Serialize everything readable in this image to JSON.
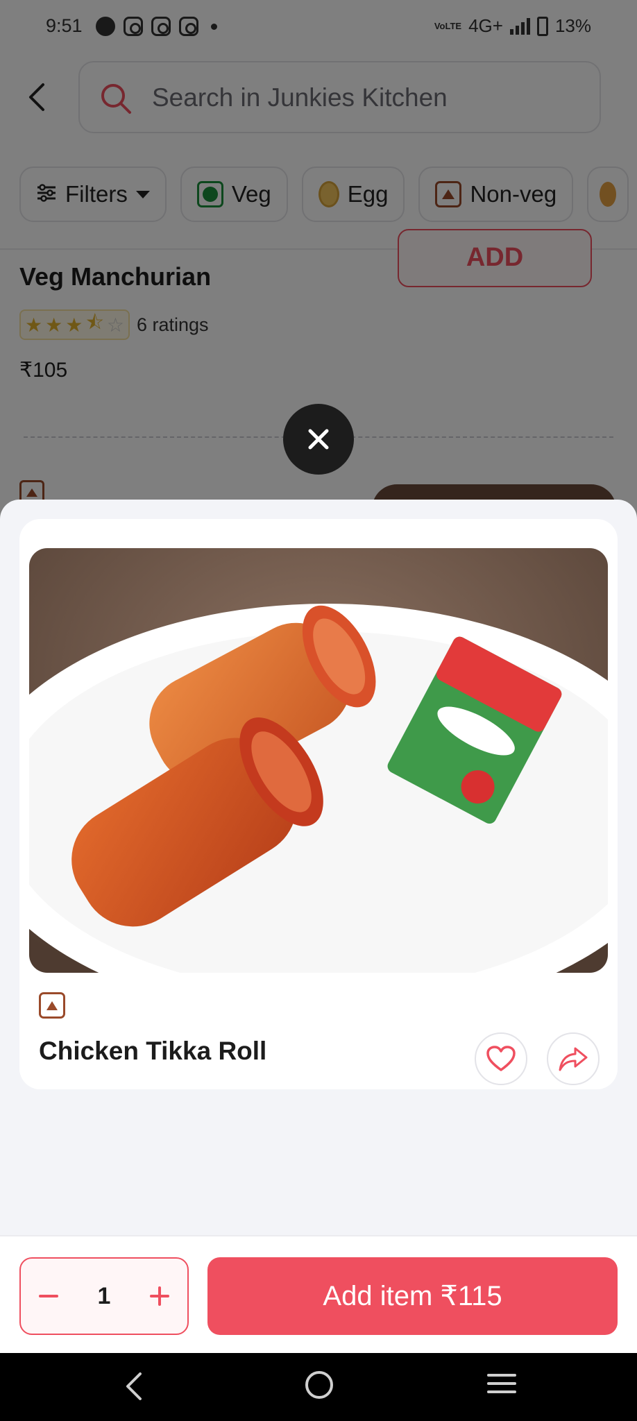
{
  "status_bar": {
    "time": "9:51",
    "network": "4G+",
    "volte": "VoLTE",
    "battery": "13%"
  },
  "header": {
    "search_placeholder": "Search in Junkies Kitchen"
  },
  "filters": {
    "items": [
      {
        "label": "Filters",
        "icon": "sliders-icon"
      },
      {
        "label": "Veg",
        "icon": "veg-icon"
      },
      {
        "label": "Egg",
        "icon": "egg-icon"
      },
      {
        "label": "Non-veg",
        "icon": "non-veg-icon"
      }
    ]
  },
  "background_item": {
    "add_label": "ADD",
    "name": "Veg Manchurian",
    "rating_stars": 3.5,
    "rating_count": "6 ratings",
    "price": "₹105"
  },
  "modal": {
    "item_name": "Chicken Tikka Roll",
    "food_type": "non-veg",
    "favorite_icon": "heart-icon",
    "share_icon": "share-icon"
  },
  "action_bar": {
    "quantity": "1",
    "add_item_label": "Add item ₹115"
  },
  "colors": {
    "brand": "#ef4f5f",
    "veg": "#1a8f3a",
    "non_veg": "#9a4a2a"
  }
}
